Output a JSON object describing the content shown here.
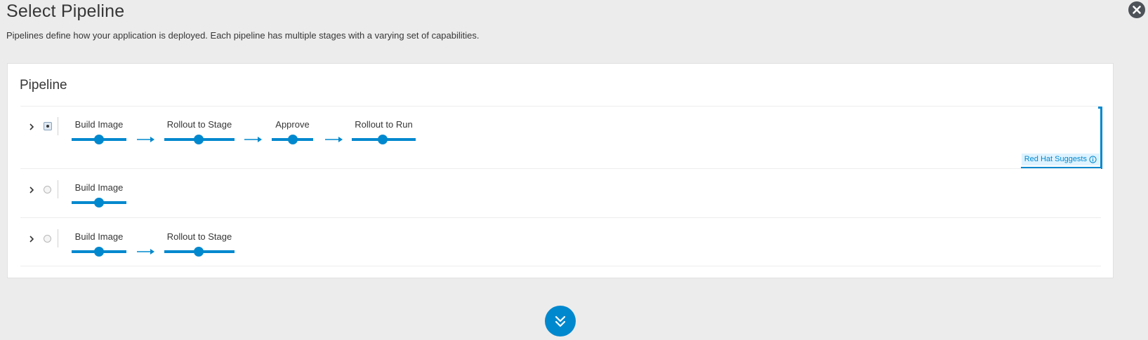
{
  "header": {
    "title": "Select Pipeline",
    "description": "Pipelines define how your application is deployed. Each pipeline has multiple stages with a varying set of capabilities."
  },
  "card": {
    "title": "Pipeline",
    "suggest_label": "Red Hat Suggests",
    "pipelines": [
      {
        "selected": true,
        "stages": [
          "Build Image",
          "Rollout to Stage",
          "Approve",
          "Rollout to Run"
        ]
      },
      {
        "selected": false,
        "stages": [
          "Build Image"
        ]
      },
      {
        "selected": false,
        "stages": [
          "Build Image",
          "Rollout to Stage"
        ]
      }
    ]
  },
  "icons": {
    "close": "close-icon",
    "expand": "chevron-right-icon",
    "info": "info-icon",
    "scroll": "double-chevron-down-icon"
  },
  "colors": {
    "accent": "#0088ce",
    "badge_background": "#def3ff",
    "close_background": "#4d5258"
  }
}
